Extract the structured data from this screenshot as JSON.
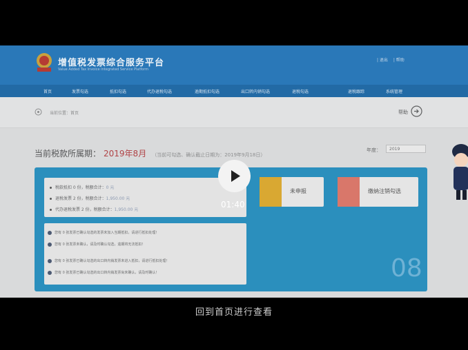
{
  "header": {
    "title": "增值税发票综合服务平台",
    "subtitle": "Value Added Tax Invoice Integrated Service Platform",
    "right_links": [
      "| 退出",
      "| 帮助"
    ]
  },
  "nav_items": [
    "首页",
    "发票勾选",
    "抵扣勾选",
    "代办退税勾选",
    "逾期抵扣勾选",
    "出口转内销勾选",
    "退税勾选",
    "退税跟踪",
    "系统管理"
  ],
  "breadcrumb": {
    "text": "当前位置：首页"
  },
  "help": {
    "label": "帮助"
  },
  "period": {
    "label": "当前税款所属期：",
    "value": "2019年8月",
    "note": "（当前可勾选、确认截止日期为：2019年9月18日）"
  },
  "year": {
    "label": "年度：",
    "value": "2019"
  },
  "stats": [
    {
      "text": "税款抵扣 0 份，税额合计：",
      "amount": "0 元"
    },
    {
      "text": "退税发票 2 份，税额合计：",
      "amount": "1,950.00 元"
    },
    {
      "text": "代办退税发票 2 份，税额合计：",
      "amount": "1,950.00 元"
    }
  ],
  "tiles": [
    {
      "label": "未申报",
      "color": "#d9a832"
    },
    {
      "label": "缴纳注销勾选",
      "color": "#d9776a"
    }
  ],
  "notices": [
    "您有 0 张发票已确认勾选的发票未加入当期抵扣，请进行抵扣处理！",
    "您有 0 张发票未确认，请及时确认勾选，逾期将无法抵扣！",
    "您有 0 张发票已确认勾选的出口转内销发票未进入抵扣，请进行抵扣处理！",
    "您有 0 张发票已确认勾选的出口转内销发票尚未确认，请及时确认！"
  ],
  "big_number": "08",
  "player": {
    "time": "01:40"
  },
  "subtitle": "回到首页进行查看"
}
